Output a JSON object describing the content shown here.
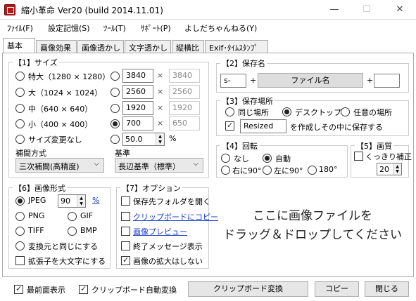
{
  "window": {
    "title": "縮小革命 Ver20 (build 2014.11.01)",
    "min": "—",
    "max": "☐",
    "close": "✕"
  },
  "menu": [
    "ﾌｧｲﾙ(F)",
    "設定記憶(S)",
    "ﾂｰﾙ(T)",
    "ｻﾎﾟｰﾄ(P)",
    "よしだちゃんねる(Y)"
  ],
  "tabs": [
    "基本",
    "画像効果",
    "画像透かし",
    "文字透かし",
    "縦横比",
    "Exif･ﾀｲﾑｽﾀﾝﾌﾟ"
  ],
  "size": {
    "label": "【1】サイズ",
    "presets": [
      "特大（1280 × 1280）",
      "大（1024 × 1024）",
      "中（640 × 640）",
      "小（400 × 400）",
      "サイズ変更なし"
    ],
    "custom": [
      {
        "w": "3840",
        "h": "3840"
      },
      {
        "w": "2560",
        "h": "2560"
      },
      {
        "w": "1920",
        "h": "1920"
      },
      {
        "w": "700",
        "h": "650"
      }
    ],
    "times": "×",
    "percent": "50.0",
    "percent_unit": "%",
    "interp_label": "補間方式",
    "interp_value": "三次補間(高精度)",
    "basis_label": "基準",
    "basis_value": "長辺基準（標準）"
  },
  "format": {
    "label": "【6】画像形式",
    "jpeg": "JPEG",
    "quality": "90",
    "percent_link": "%",
    "png": "PNG",
    "gif": "GIF",
    "tiff": "TIFF",
    "bmp": "BMP",
    "same": "変換元と同じにする",
    "upper_ext": "拡張子を大文字にする"
  },
  "options": {
    "label": "【7】オプション",
    "open_folder": "保存先フォルダを開く",
    "clipboard_copy": "クリップボードにコピー",
    "preview": "画像プレビュー",
    "end_msg": "終了メッセージ表示",
    "no_enlarge": "画像の拡大はしない"
  },
  "savename": {
    "label": "【2】保存名",
    "prefix": "s-",
    "plus": "+",
    "file_button": "ファイル名",
    "suffix": ""
  },
  "saveloc": {
    "label": "【3】保存場所",
    "same": "同じ場所",
    "desktop": "デスクトップ",
    "any": "任意の場所",
    "folder": "Resized",
    "folder_text": "を作成しその中に保存する"
  },
  "rotate": {
    "label": "【4】回転",
    "none": "なし",
    "auto": "自動",
    "right": "右に90°",
    "left": "左に90°",
    "r180": "180°"
  },
  "quality": {
    "label": "【5】画質",
    "sharp": "くっきり補正",
    "value": "20"
  },
  "drop": {
    "line1": "ここに画像ファイルを",
    "line2": "ドラッグ＆ドロップしてください"
  },
  "bottom": {
    "topmost": "最前面表示",
    "clip_watch": "クリップボード自動変換",
    "clip_convert": "クリップボード変換",
    "copy": "コピー",
    "close": "閉じる"
  },
  "colors": {
    "accent": "#1a3fc8",
    "icon": "#b31b1b"
  }
}
